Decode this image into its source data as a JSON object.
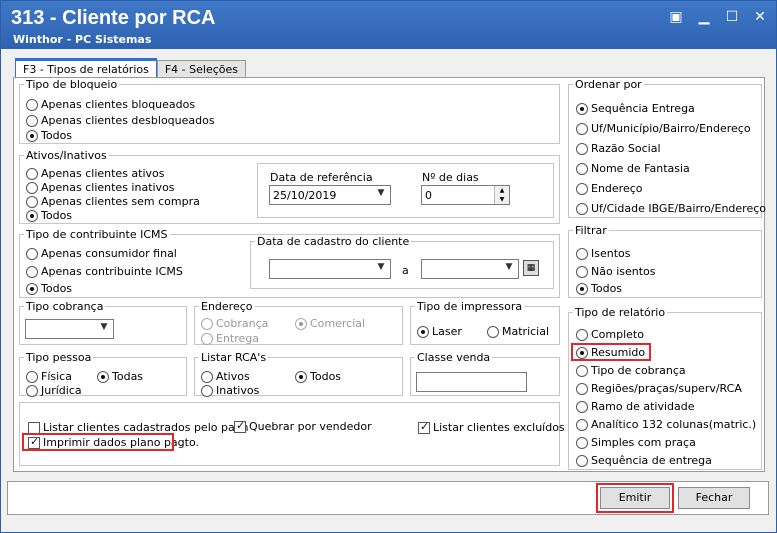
{
  "window": {
    "title": "313 - Cliente por RCA",
    "subtitle": "Winthor - PC Sistemas",
    "controls": {
      "restore": "▣",
      "minimize": "▁",
      "maximize": "☐",
      "close": "✕"
    }
  },
  "tabs": [
    {
      "label": "F3 - Tipos de relatórios"
    },
    {
      "label": "F4 - Seleções"
    }
  ],
  "tipo_bloqueio": {
    "legend": "Tipo de bloqueio",
    "options": [
      "Apenas clientes bloqueados",
      "Apenas clientes desbloqueados",
      "Todos"
    ]
  },
  "ativos_inativos": {
    "legend": "Ativos/Inativos",
    "options": [
      "Apenas clientes ativos",
      "Apenas clientes inativos",
      "Apenas clientes sem compra",
      "Todos"
    ],
    "data_referencia_label": "Data de referência",
    "data_referencia_value": "25/10/2019",
    "num_dias_label": "Nº de dias",
    "num_dias_value": "0"
  },
  "contribuinte_icms": {
    "legend": "Tipo de contribuinte ICMS",
    "options": [
      "Apenas consumidor final",
      "Apenas contribuinte ICMS",
      "Todos"
    ]
  },
  "data_cadastro": {
    "legend": "Data de cadastro do cliente",
    "from_value": "",
    "to_label": "a",
    "to_value": ""
  },
  "tipo_cobranca": {
    "legend": "Tipo cobrança",
    "value": ""
  },
  "endereco": {
    "legend": "Endereço",
    "options": [
      "Cobrança",
      "Comercial",
      "Entrega"
    ]
  },
  "tipo_impressora": {
    "legend": "Tipo de impressora",
    "options": [
      "Laser",
      "Matricial"
    ]
  },
  "tipo_pessoa": {
    "legend": "Tipo pessoa",
    "options": [
      "Física",
      "Todas",
      "Jurídica"
    ]
  },
  "listar_rcas": {
    "legend": "Listar RCA's",
    "options": [
      "Ativos",
      "Todos",
      "Inativos"
    ]
  },
  "classe_venda": {
    "legend": "Classe venda",
    "value": ""
  },
  "checks": {
    "listar_palm": "Listar clientes cadastrados pelo palm",
    "quebrar_vendedor": "Quebrar por vendedor",
    "listar_excluidos": "Listar clientes excluídos",
    "imprimir_plano": "Imprimir dados plano pagto."
  },
  "ordenar_por": {
    "legend": "Ordenar por",
    "options": [
      "Sequência Entrega",
      "Uf/Município/Bairro/Endereço",
      "Razão Social",
      "Nome de Fantasia",
      "Endereço",
      "Uf/Cidade IBGE/Bairro/Endereço"
    ]
  },
  "filtrar": {
    "legend": "Filtrar",
    "options": [
      "Isentos",
      "Não isentos",
      "Todos"
    ]
  },
  "tipo_relatorio": {
    "legend": "Tipo de relatório",
    "options": [
      "Completo",
      "Resumido",
      "Tipo de cobrança",
      "Regiões/praças/superv/RCA",
      "Ramo de atividade",
      "Analítico 132 colunas(matric.)",
      "Simples com praça",
      "Sequência de entrega"
    ]
  },
  "buttons": {
    "emitir": "Emitir",
    "fechar": "Fechar"
  },
  "highlight_color": "#e3262b"
}
